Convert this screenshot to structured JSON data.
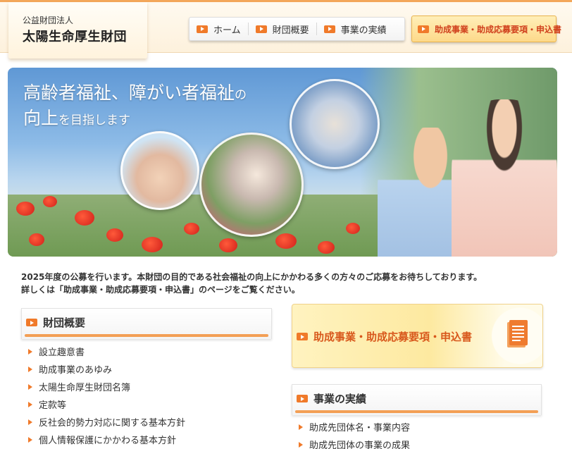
{
  "header": {
    "org_type": "公益財団法人",
    "org_name": "太陽生命厚生財団",
    "nav": [
      {
        "label": "ホーム"
      },
      {
        "label": "財団概要"
      },
      {
        "label": "事業の実績"
      }
    ],
    "apply_label": "助成事業・助成応募要項・申込書"
  },
  "hero": {
    "line1_a": "高齢者福祉、障がい者福祉",
    "line1_b": "の",
    "line2_a": "向上",
    "line2_b": "を目指します"
  },
  "intro": {
    "line1": "2025年度の公募を行います。本財団の目的である社会福祉の向上にかかわる多くの方々のご応募をお待ちしております。",
    "line2": "詳しくは「助成事業・助成応募要項・申込書」のページをご覧ください。"
  },
  "foundation": {
    "title": "財団概要",
    "items": [
      "設立趣意書",
      "助成事業のあゆみ",
      "太陽生命厚生財団名簿",
      "定款等",
      "反社会的勢力対応に関する基本方針",
      "個人情報保護にかかわる基本方針"
    ]
  },
  "apply_banner": {
    "label": "助成事業・助成応募要項・申込書"
  },
  "results": {
    "title": "事業の実績",
    "items": [
      "助成先団体名・事業内容",
      "助成先団体の事業の成果"
    ]
  },
  "colors": {
    "accent_orange": "#f07a2a",
    "apply_red": "#d0401c",
    "header_bg": "#fdf1dc"
  }
}
